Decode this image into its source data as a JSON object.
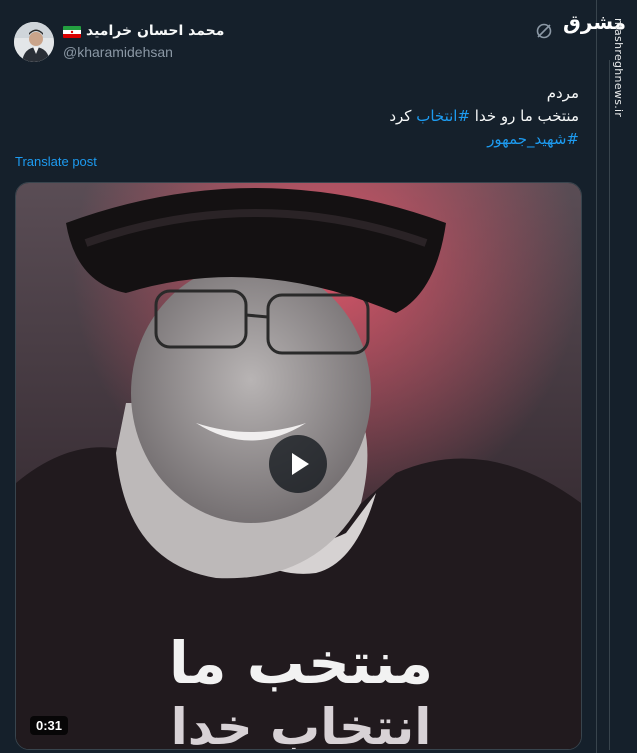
{
  "watermark": {
    "logo_text": "مشرق",
    "domain": "mashreghnews.ir"
  },
  "tweet": {
    "author_name": "محمد احسان خرامید",
    "handle": "@kharamidehsan",
    "text_line1": "مردم",
    "text_line2_part1": "منتخب ما رو خدا ",
    "text_line2_hashtag": "#انتخاب",
    "text_line2_part2": " کرد",
    "hashtag_line3": "#شهید_جمهور",
    "translate_label": "Translate post"
  },
  "media": {
    "type": "video",
    "duration": "0:31",
    "overlay_line1": "منتخب ما",
    "overlay_line2": "انتخاب خدا"
  },
  "icons": {
    "grok": "grok-icon",
    "play": "play-icon",
    "flag": "iran-flag-icon"
  },
  "colors": {
    "background": "#15202b",
    "text_primary": "#f7f9f9",
    "text_secondary": "#8b98a5",
    "link": "#1d9bf0",
    "border": "#38444d"
  }
}
